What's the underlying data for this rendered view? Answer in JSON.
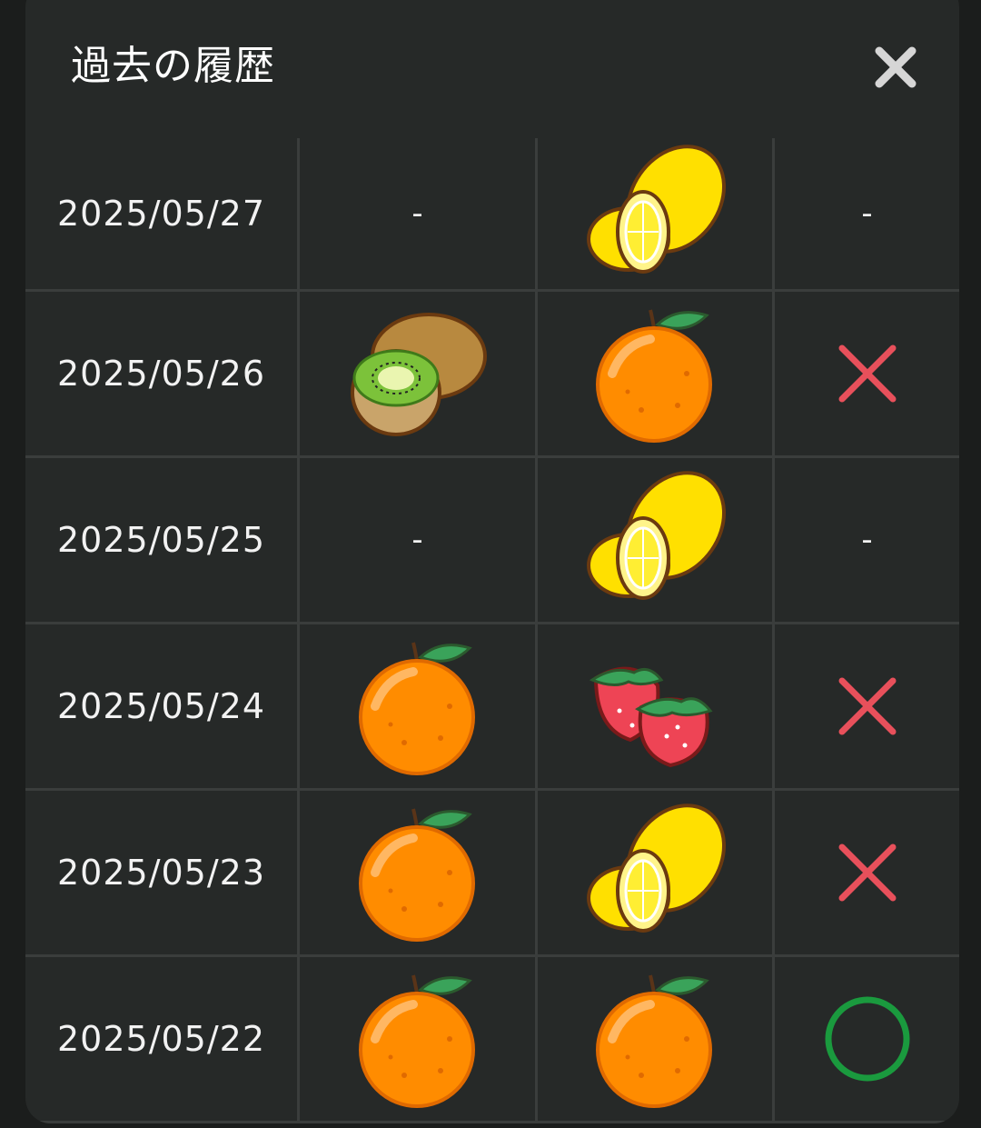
{
  "modal": {
    "title": "過去の履歴",
    "close_icon": "close-icon"
  },
  "colors": {
    "background": "#262928",
    "cross": "#e8505b",
    "circle": "#1a9a3e",
    "grid": "#3a3d3c"
  },
  "rows": [
    {
      "date": "2025/05/27",
      "first": "-",
      "second": "lemon",
      "result": "-"
    },
    {
      "date": "2025/05/26",
      "first": "kiwi",
      "second": "orange",
      "result": "cross"
    },
    {
      "date": "2025/05/25",
      "first": "-",
      "second": "lemon",
      "result": "-"
    },
    {
      "date": "2025/05/24",
      "first": "orange",
      "second": "strawberry",
      "result": "cross"
    },
    {
      "date": "2025/05/23",
      "first": "orange",
      "second": "lemon",
      "result": "cross"
    },
    {
      "date": "2025/05/22",
      "first": "orange",
      "second": "orange",
      "result": "circle"
    }
  ]
}
